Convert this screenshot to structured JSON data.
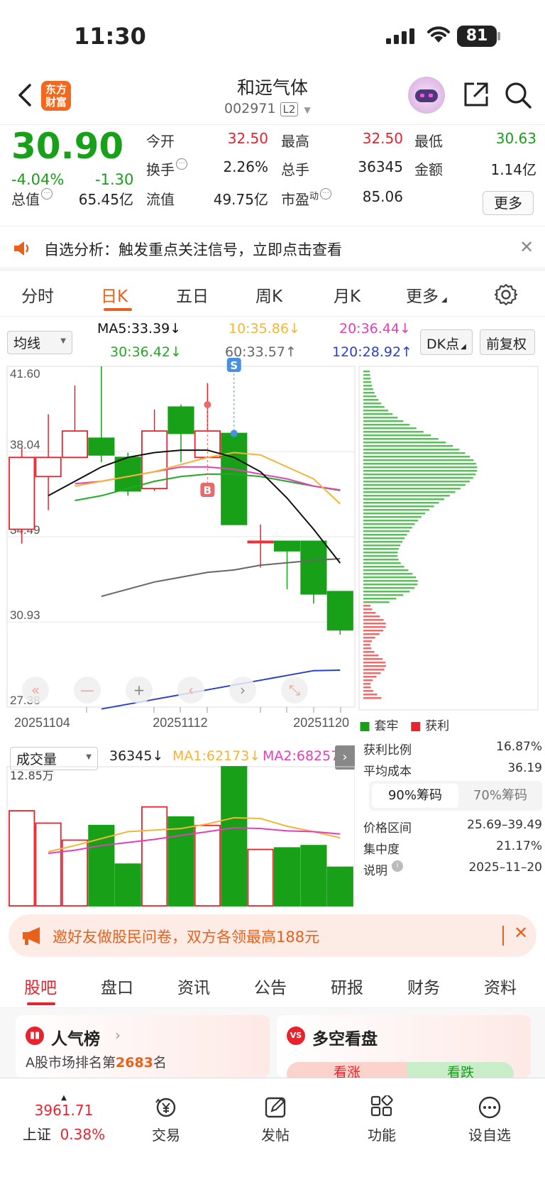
{
  "status": {
    "time": "11:30",
    "battery": "81"
  },
  "header": {
    "logo": "东方财富",
    "title": "和远气体",
    "code": "002971",
    "level": "L2"
  },
  "quote": {
    "price": "30.90",
    "change_pct": "-4.04%",
    "change": "-1.30",
    "open_label": "今开",
    "open": "32.50",
    "high_label": "最高",
    "high": "32.50",
    "low_label": "最低",
    "low": "30.63",
    "turnover_label": "换手",
    "turnover": "2.26%",
    "volume_label": "总手",
    "volume": "36345",
    "amount_label": "金额",
    "amount": "1.14亿",
    "mktcap_label": "总值",
    "mktcap": "65.45亿",
    "float_label": "流值",
    "float": "49.75亿",
    "pe_label": "市盈",
    "pe_sup": "动",
    "pe": "85.06",
    "more": "更多"
  },
  "notice": {
    "text": "自选分析：触发重点关注信号，立即点击查看"
  },
  "ktabs": [
    "分时",
    "日K",
    "五日",
    "周K",
    "月K",
    "更多"
  ],
  "ma_bar": {
    "select": "均线",
    "ma5": "MA5:33.39↓",
    "ma10": "10:35.86↓",
    "ma20": "20:36.44↓",
    "ma30": "30:36.42↓",
    "ma60": "60:33.57↑",
    "ma120": "120:28.92↑",
    "dk": "DK点",
    "fq": "前复权"
  },
  "price_axis": [
    "41.60",
    "38.04",
    "34.49",
    "30.93",
    "27.38"
  ],
  "date_axis": [
    "20251104",
    "20251112",
    "20251120"
  ],
  "markers": {
    "sell": "S",
    "buy": "B"
  },
  "colors": {
    "up": "#e8232e",
    "down": "#18a018",
    "ma5": "#111111",
    "ma10": "#f5b433",
    "ma20": "#e040b8",
    "ma30": "#22aa22",
    "ma60": "#666666",
    "ma120": "#2a40c8"
  },
  "chart_data": {
    "type": "candlestick",
    "candles": [
      {
        "o": 34.8,
        "c": 37.8,
        "h": 38.2,
        "l": 34.2
      },
      {
        "o": 37.0,
        "c": 37.8,
        "h": 39.6,
        "l": 35.6
      },
      {
        "o": 37.8,
        "c": 38.9,
        "h": 40.8,
        "l": 37.8
      },
      {
        "o": 38.6,
        "c": 37.9,
        "h": 41.6,
        "l": 37.6
      },
      {
        "o": 37.8,
        "c": 36.4,
        "h": 38.0,
        "l": 36.2
      },
      {
        "o": 36.5,
        "c": 38.9,
        "h": 39.8,
        "l": 36.4
      },
      {
        "o": 39.9,
        "c": 38.8,
        "h": 40.0,
        "l": 37.6
      },
      {
        "o": 37.8,
        "c": 38.9,
        "h": 40.9,
        "l": 37.8
      },
      {
        "o": 38.8,
        "c": 35.0,
        "h": 38.8,
        "l": 35.0
      },
      {
        "o": 34.3,
        "c": 34.3,
        "h": 35.0,
        "l": 33.2
      },
      {
        "o": 34.3,
        "c": 33.9,
        "h": 34.3,
        "l": 32.3
      },
      {
        "o": 34.3,
        "c": 32.1,
        "h": 34.3,
        "l": 31.7
      },
      {
        "o": 32.2,
        "c": 30.6,
        "h": 32.2,
        "l": 30.4
      }
    ],
    "ma5": [
      36.2,
      36.8,
      37.4,
      37.8,
      38.0,
      38.1,
      38.1,
      37.8,
      37.2,
      36.1,
      34.8,
      33.39
    ],
    "ma10": [
      36.6,
      36.8,
      37.0,
      37.2,
      37.5,
      37.8,
      38.0,
      37.9,
      37.4,
      36.9,
      35.86
    ],
    "ma20": [
      36.7,
      36.8,
      37.0,
      37.2,
      37.4,
      37.4,
      37.3,
      37.1,
      36.9,
      36.6,
      36.44
    ],
    "ma30": [
      36.0,
      36.2,
      36.5,
      36.8,
      37.0,
      37.1,
      37.1,
      37.0,
      36.8,
      36.6,
      36.42
    ],
    "ma60": [
      32.0,
      32.3,
      32.6,
      32.8,
      33.0,
      33.1,
      33.3,
      33.4,
      33.5,
      33.57
    ],
    "ma120": [
      27.3,
      27.5,
      27.7,
      27.9,
      28.1,
      28.3,
      28.5,
      28.7,
      28.9,
      28.92
    ]
  },
  "volume": {
    "select": "成交量",
    "value": "36345↓",
    "ma1": "MA1:62173↓",
    "ma2": "MA2:68257",
    "max_label": "12.85万",
    "bars": [
      12.3,
      10.7,
      8.5,
      10.4,
      5.4,
      12.8,
      11.5,
      10.4,
      18.0,
      7.3,
      7.5,
      7.8,
      5.0
    ]
  },
  "chip": {
    "legend_trap": "套牢",
    "legend_profit": "获利",
    "profit_ratio_label": "获利比例",
    "profit_ratio": "16.87%",
    "avg_cost_label": "平均成本",
    "avg_cost": "36.19",
    "tab90": "90%筹码",
    "tab70": "70%筹码",
    "range_label": "价格区间",
    "range": "25.69–39.49",
    "concentration_label": "集中度",
    "concentration": "21.17%",
    "note_label": "说明",
    "date": "2025–11–20"
  },
  "promo": {
    "text": "邀好友做股民问卷，双方各领最高188元"
  },
  "btabs": [
    "股吧",
    "盘口",
    "资讯",
    "公告",
    "研报",
    "财务",
    "资料"
  ],
  "cards": {
    "hot": {
      "title": "人气榜",
      "desc_prefix": "A股市场排名第",
      "rank": "2683",
      "desc_suffix": "名"
    },
    "vs": {
      "title": "多空看盘",
      "up": "看涨",
      "down": "看跌"
    }
  },
  "bottom": {
    "index_value": "3961.71",
    "index_name": "上证",
    "index_pct": "0.38%",
    "trade": "交易",
    "post": "发帖",
    "func": "功能",
    "watch": "设自选"
  }
}
